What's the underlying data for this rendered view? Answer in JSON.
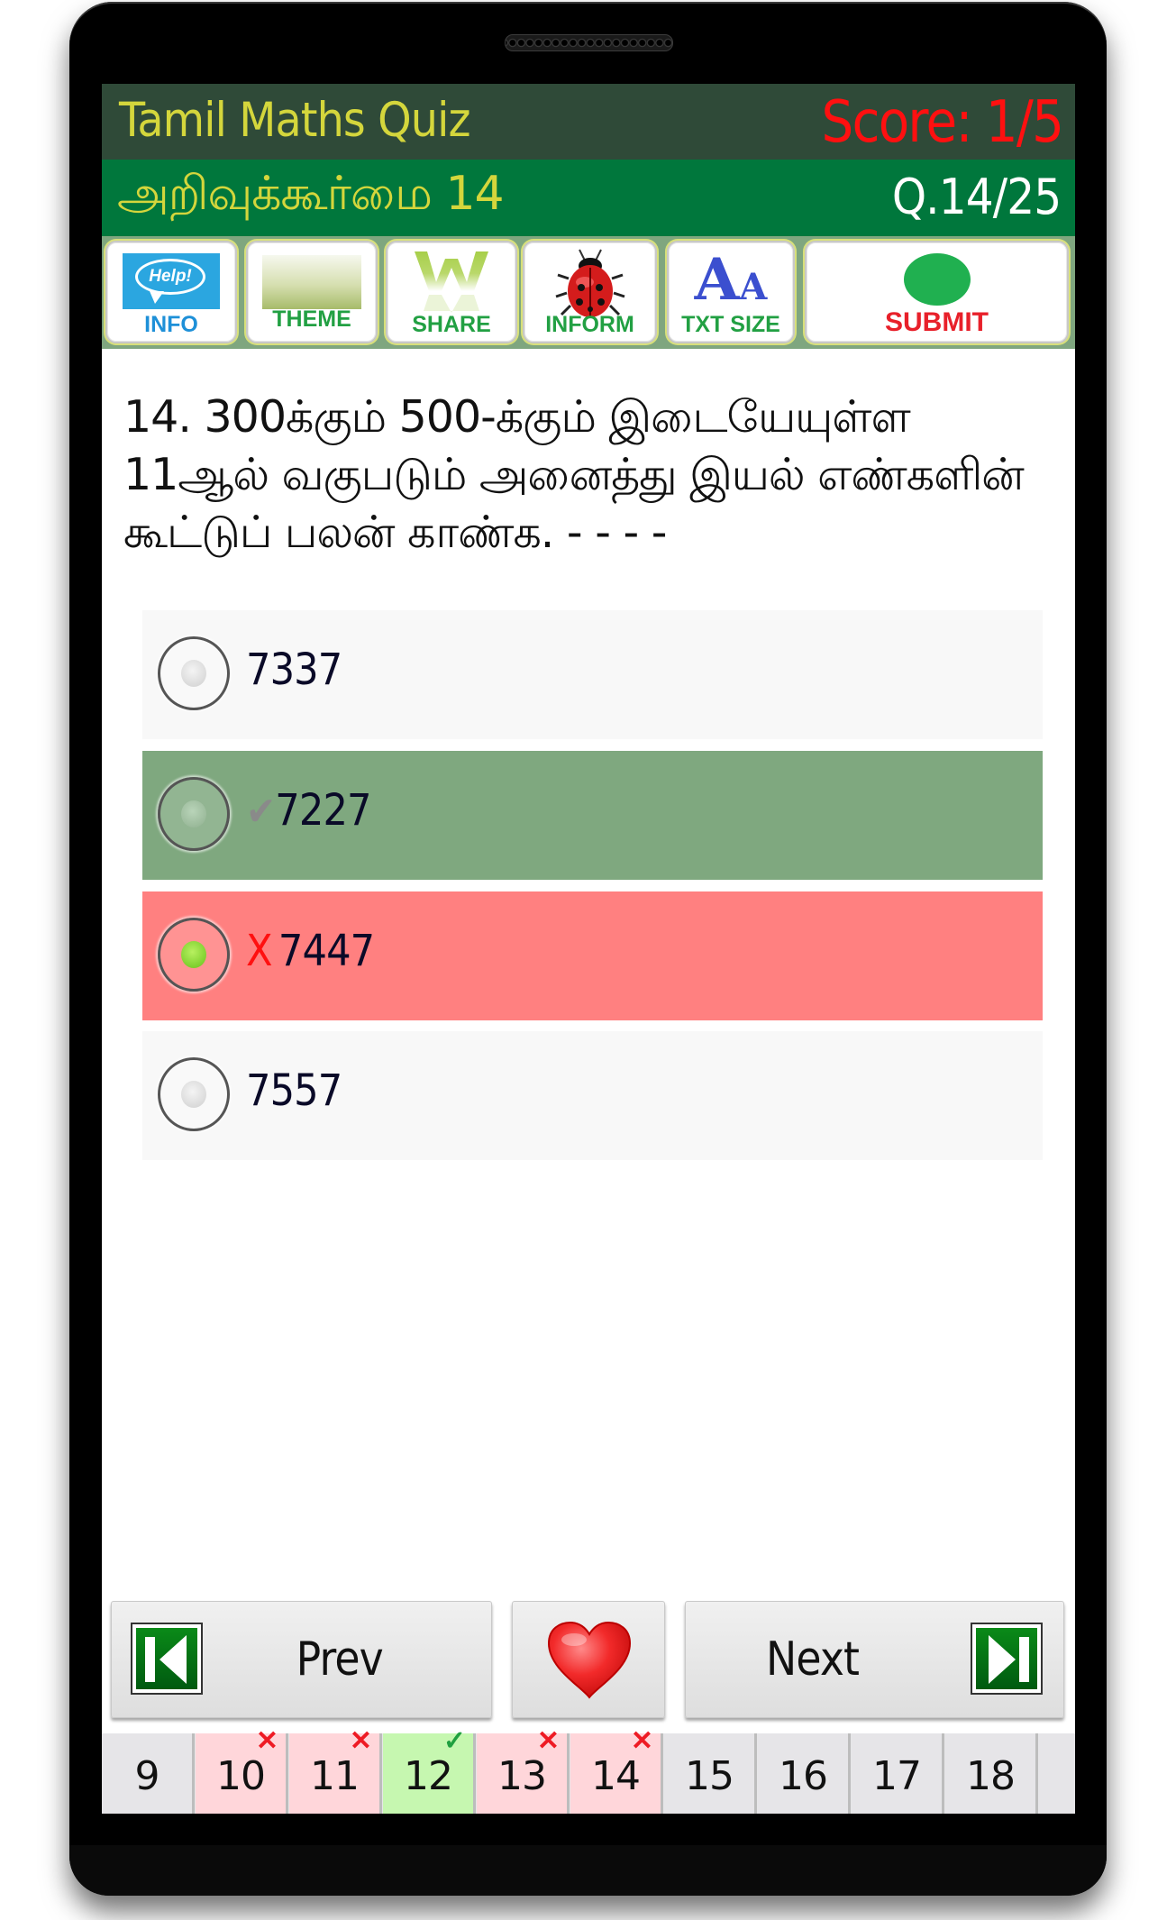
{
  "header": {
    "app_title": "Tamil Maths Quiz",
    "score": "Score: 1/5",
    "section_title": "அறிவுக்கூர்மை 14",
    "question_counter": "Q.14/25"
  },
  "toolbar": {
    "buttons": [
      {
        "label": "INFO",
        "icon": "help-bubble-icon",
        "icon_text": "Help!",
        "color": "#1E90D8"
      },
      {
        "label": "THEME",
        "icon": "theme-swatch-icon",
        "color": "#22A043"
      },
      {
        "label": "SHARE",
        "icon": "share-w-icon",
        "color": "#22A043"
      },
      {
        "label": "INFORM",
        "icon": "ladybug-icon",
        "color": "#22A043"
      },
      {
        "label": "TXT SIZE",
        "icon": "text-size-icon",
        "icon_text_big": "A",
        "icon_text_small": "A",
        "color": "#22A043"
      },
      {
        "label": "SUBMIT",
        "icon": "green-dot-icon",
        "color": "#E8202A"
      }
    ]
  },
  "question": {
    "text": "14. 300க்கும் 500-க்கும் இடையேயுள்ள 11ஆல் வகுபடும் அனைத்து இயல் எண்களின் கூட்டுப் பலன் காண்க. - - - -"
  },
  "options": [
    {
      "value": "7337",
      "state": "neutral",
      "selected": false,
      "mark": ""
    },
    {
      "value": "7227",
      "state": "correct",
      "selected": false,
      "mark": "✔"
    },
    {
      "value": "7447",
      "state": "wrong",
      "selected": true,
      "mark": "X"
    },
    {
      "value": "7557",
      "state": "neutral",
      "selected": false,
      "mark": ""
    }
  ],
  "navigation": {
    "prev_label": "Prev",
    "next_label": "Next",
    "favorite_icon": "heart-icon"
  },
  "pager": {
    "items": [
      {
        "number": "9",
        "status": "unanswered",
        "badge": ""
      },
      {
        "number": "10",
        "status": "wrong",
        "badge": "✕"
      },
      {
        "number": "11",
        "status": "wrong",
        "badge": "✕"
      },
      {
        "number": "12",
        "status": "correct",
        "badge": "✓"
      },
      {
        "number": "13",
        "status": "wrong",
        "badge": "✕"
      },
      {
        "number": "14",
        "status": "wrong",
        "badge": "✕"
      },
      {
        "number": "15",
        "status": "unanswered",
        "badge": ""
      },
      {
        "number": "16",
        "status": "unanswered",
        "badge": ""
      },
      {
        "number": "17",
        "status": "unanswered",
        "badge": ""
      },
      {
        "number": "18",
        "status": "unanswered",
        "badge": ""
      }
    ]
  },
  "colors": {
    "header_dark": "#2F4A38",
    "header_green": "#00773C",
    "title_yellow": "#D4D63C",
    "score_red": "#FF1010",
    "correct_bg": "#7FA87F",
    "wrong_bg": "#FF8080"
  }
}
